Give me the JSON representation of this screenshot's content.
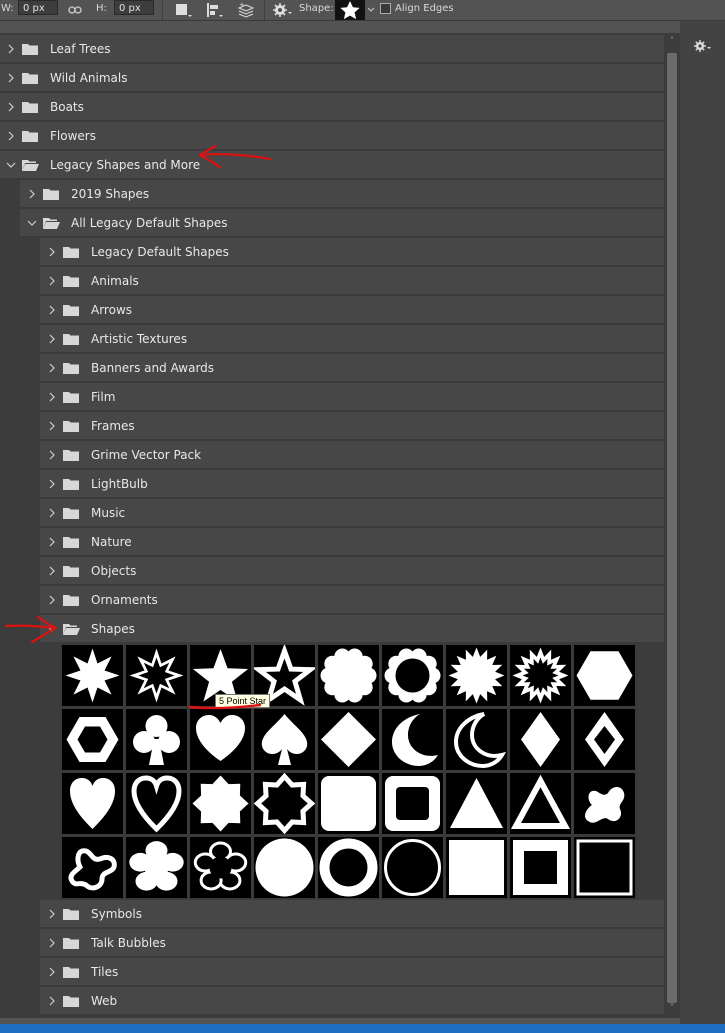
{
  "options_bar": {
    "w_label": "W:",
    "w_value": "0 px",
    "h_label": "H:",
    "h_value": "0 px",
    "shape_label": "Shape:",
    "align_edges_label": "Align Edges"
  },
  "tree": {
    "top_items": [
      {
        "label": "Leaf Trees"
      },
      {
        "label": "Wild Animals"
      },
      {
        "label": "Boats"
      },
      {
        "label": "Flowers"
      },
      {
        "label": "Legacy Shapes and More"
      }
    ],
    "legacy_children": [
      {
        "label": "2019 Shapes"
      },
      {
        "label": "All Legacy Default Shapes"
      }
    ],
    "all_legacy_children": [
      {
        "label": "Legacy Default Shapes"
      },
      {
        "label": "Animals"
      },
      {
        "label": "Arrows"
      },
      {
        "label": "Artistic Textures"
      },
      {
        "label": "Banners and Awards"
      },
      {
        "label": "Film"
      },
      {
        "label": "Frames"
      },
      {
        "label": "Grime Vector Pack"
      },
      {
        "label": "LightBulb"
      },
      {
        "label": "Music"
      },
      {
        "label": "Nature"
      },
      {
        "label": "Objects"
      },
      {
        "label": "Ornaments"
      },
      {
        "label": "Shapes"
      }
    ],
    "after_grid": [
      {
        "label": "Symbols"
      },
      {
        "label": "Talk Bubbles"
      },
      {
        "label": "Tiles"
      },
      {
        "label": "Web"
      }
    ]
  },
  "tooltip": "5 Point Star",
  "shapes": [
    "burst-8",
    "burst-8-outline",
    "star-5",
    "star-5-outline",
    "scallop",
    "scallop-outline",
    "burst-16",
    "burst-16-outline",
    "hexagon",
    "hexagon-outline",
    "club",
    "heart-card",
    "spade",
    "diamond",
    "moon",
    "moon-outline",
    "diamond-card",
    "diamond-card-outline",
    "heart",
    "heart-outline",
    "octagram",
    "octagram-outline",
    "rounded-square",
    "rounded-square-outline",
    "triangle",
    "triangle-outline",
    "blob",
    "blob-outline",
    "flower",
    "flower-outline",
    "circle",
    "circle-outline-thick",
    "circle-outline-thin",
    "square",
    "square-outline-thick",
    "square-outline-thin"
  ]
}
